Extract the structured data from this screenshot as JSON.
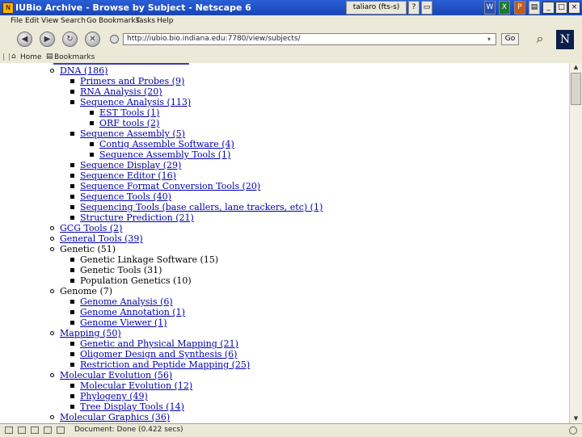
{
  "window": {
    "title": "IUBio Archive - Browse by Subject - Netscape 6",
    "taskbar_item": "taliaro (fts-s)",
    "minimize": "_",
    "maximize": "□",
    "close": "×"
  },
  "menu": [
    "File",
    "Edit",
    "View",
    "Search",
    "Go",
    "Bookmarks",
    "Tasks",
    "Help"
  ],
  "toolbar": {
    "url": "http://iubio.bio.indiana.edu:7780/view/subjects/",
    "go_label": "Go"
  },
  "bookmarks_bar": {
    "home": "Home",
    "bookmarks": "Bookmarks"
  },
  "status": "Document: Done (0.422 secs)",
  "tree": [
    {
      "level": 1,
      "text": "DNA (186)",
      "link": true
    },
    {
      "level": 2,
      "text": "Primers and Probes (9)",
      "link": true
    },
    {
      "level": 2,
      "text": "RNA Analysis (20)",
      "link": true
    },
    {
      "level": 2,
      "text": "Sequence Analysis (113)",
      "link": true
    },
    {
      "level": 3,
      "text": "EST Tools (1)",
      "link": true
    },
    {
      "level": 3,
      "text": "ORF tools (2)",
      "link": true
    },
    {
      "level": 2,
      "text": "Sequence Assembly (5)",
      "link": true
    },
    {
      "level": 3,
      "text": "Contig Assemble Software (4)",
      "link": true
    },
    {
      "level": 3,
      "text": "Sequence Assembly Tools (1)",
      "link": true
    },
    {
      "level": 2,
      "text": "Sequence Display (29)",
      "link": true
    },
    {
      "level": 2,
      "text": "Sequence Editor (16)",
      "link": true
    },
    {
      "level": 2,
      "text": "Sequence Format Conversion Tools (20)",
      "link": true
    },
    {
      "level": 2,
      "text": "Sequence Tools (40)",
      "link": true
    },
    {
      "level": 2,
      "text": "Sequencing Tools (base callers, lane trackers, etc) (1)",
      "link": true
    },
    {
      "level": 2,
      "text": "Structure Prediction (21)",
      "link": true
    },
    {
      "level": 1,
      "text": "GCG Tools (2)",
      "link": true
    },
    {
      "level": 1,
      "text": "General Tools (39)",
      "link": true
    },
    {
      "level": 1,
      "text": "Genetic (51)",
      "link": false
    },
    {
      "level": 2,
      "text": "Genetic Linkage Software (15)",
      "link": false
    },
    {
      "level": 2,
      "text": "Genetic Tools (31)",
      "link": false
    },
    {
      "level": 2,
      "text": "Population Genetics (10)",
      "link": false
    },
    {
      "level": 1,
      "text": "Genome (7)",
      "link": false
    },
    {
      "level": 2,
      "text": "Genome Analysis (6)",
      "link": true
    },
    {
      "level": 2,
      "text": "Genome Annotation (1)",
      "link": true
    },
    {
      "level": 2,
      "text": "Genome Viewer (1)",
      "link": true
    },
    {
      "level": 1,
      "text": "Mapping (50)",
      "link": true
    },
    {
      "level": 2,
      "text": "Genetic and Physical Mapping (21)",
      "link": true
    },
    {
      "level": 2,
      "text": "Oligomer Design and Synthesis (6)",
      "link": true
    },
    {
      "level": 2,
      "text": "Restriction and Peptide Mapping (25)",
      "link": true
    },
    {
      "level": 1,
      "text": "Molecular Evolution (56)",
      "link": true
    },
    {
      "level": 2,
      "text": "Molecular Evolution (12)",
      "link": true
    },
    {
      "level": 2,
      "text": "Phylogeny (49)",
      "link": true
    },
    {
      "level": 2,
      "text": "Tree Display Tools (14)",
      "link": true
    },
    {
      "level": 1,
      "text": "Molecular Graphics (36)",
      "link": true
    }
  ]
}
